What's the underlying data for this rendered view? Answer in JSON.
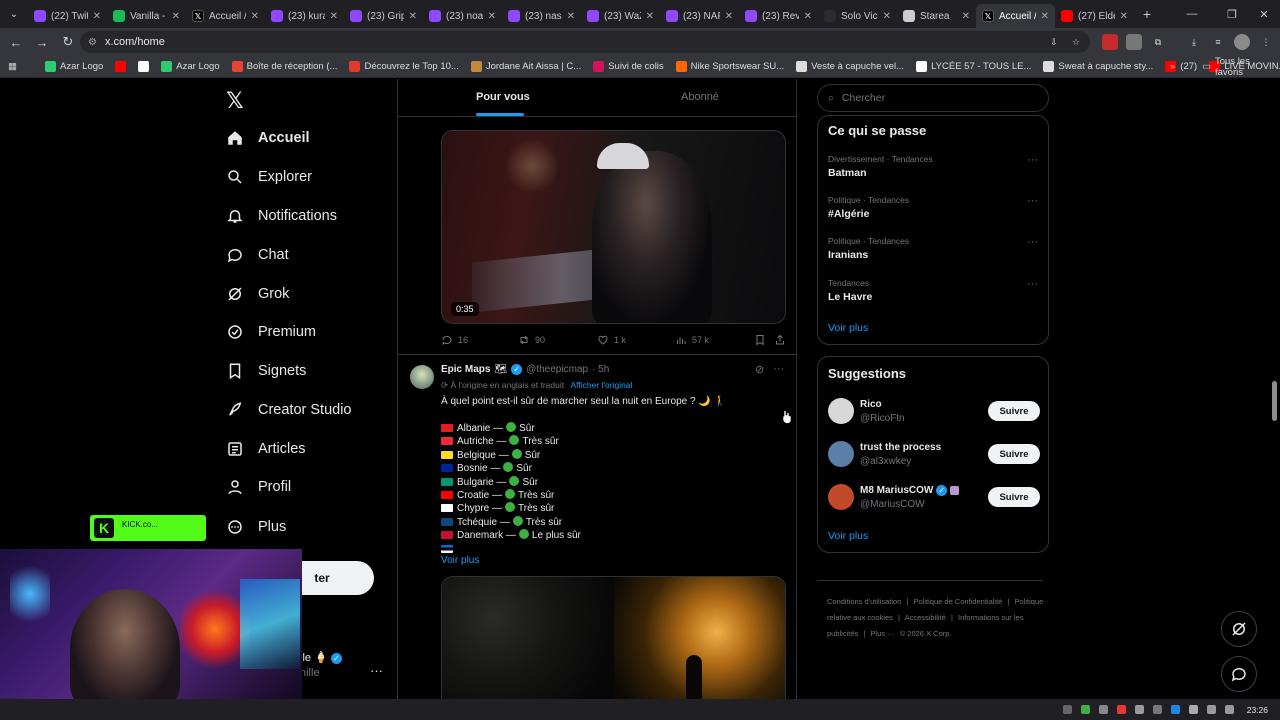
{
  "browser": {
    "tabs": [
      {
        "title": "(22) Twit",
        "color": "#9146ff",
        "icon": "twitch-icon"
      },
      {
        "title": "Vanilla -",
        "color": "#1db954",
        "icon": "spotify-icon"
      },
      {
        "title": "Accueil /",
        "color": "#000000",
        "icon": "x-icon"
      },
      {
        "title": "(23) kura",
        "color": "#9146ff",
        "icon": "twitch-icon"
      },
      {
        "title": "(23) Grip",
        "color": "#9146ff",
        "icon": "twitch-icon"
      },
      {
        "title": "(23) noal",
        "color": "#9146ff",
        "icon": "twitch-icon"
      },
      {
        "title": "(23) nas",
        "color": "#9146ff",
        "icon": "twitch-icon"
      },
      {
        "title": "(23) WaZ",
        "color": "#9146ff",
        "icon": "twitch-icon"
      },
      {
        "title": "(23) NAF",
        "color": "#9146ff",
        "icon": "twitch-icon"
      },
      {
        "title": "(23) Revi",
        "color": "#9146ff",
        "icon": "twitch-icon"
      },
      {
        "title": "Solo Vict",
        "color": "#2b2b2b",
        "icon": "globe-icon"
      },
      {
        "title": "Starea",
        "color": "#cccccc",
        "icon": "page-icon"
      },
      {
        "title": "Accueil /",
        "color": "#000000",
        "icon": "x-icon",
        "active": true
      },
      {
        "title": "(27) Elde",
        "color": "#ff0000",
        "icon": "youtube-icon"
      }
    ],
    "url": "x.com/home",
    "bookmarks": [
      {
        "label": "Azar Logo",
        "color": "#2ecc71"
      },
      {
        "label": "",
        "color": "#ff0000"
      },
      {
        "label": "",
        "color": "#ffffff"
      },
      {
        "label": "Azar Logo",
        "color": "#2ecc71"
      },
      {
        "label": "Boîte de réception (...",
        "color": "#ea4335"
      },
      {
        "label": "Découvrez le Top 10...",
        "color": "#e23a2a"
      },
      {
        "label": "Jordane Ait Aissa | C...",
        "color": "#c48a3a"
      },
      {
        "label": "Suivi de colis",
        "color": "#d4145a"
      },
      {
        "label": "Nike Sportswear SU...",
        "color": "#ff6600"
      },
      {
        "label": "Veste à capuche vel...",
        "color": "#dddddd"
      },
      {
        "label": "LYCÉE 57 - TOUS LE...",
        "color": "#ffffff"
      },
      {
        "label": "Sweat à capuche sty...",
        "color": "#dddddd"
      },
      {
        "label": "(27)",
        "color": "#ff0000"
      },
      {
        "label": "LIVE MOVIN...",
        "color": "#ff0000"
      }
    ],
    "all_bookmarks": "Tous les favoris",
    "clock": "23:26"
  },
  "sidebar": {
    "items": [
      {
        "label": "Accueil",
        "icon": "home-icon"
      },
      {
        "label": "Explorer",
        "icon": "search-icon"
      },
      {
        "label": "Notifications",
        "icon": "bell-icon"
      },
      {
        "label": "Chat",
        "icon": "chat-icon"
      },
      {
        "label": "Grok",
        "icon": "grok-icon"
      },
      {
        "label": "Premium",
        "icon": "verified-icon"
      },
      {
        "label": "Signets",
        "icon": "bookmark-icon"
      },
      {
        "label": "Creator Studio",
        "icon": "rocket-icon"
      },
      {
        "label": "Articles",
        "icon": "article-icon"
      },
      {
        "label": "Profil",
        "icon": "profile-icon"
      },
      {
        "label": "Plus",
        "icon": "more-icon"
      }
    ],
    "post_button_partial": "ter",
    "user_name_partial": "lle",
    "user_handle_partial": "nille",
    "kick_text": "KICK.co..."
  },
  "timeline": {
    "tab_for_you": "Pour vous",
    "tab_following": "Abonné",
    "post1": {
      "duration": "0:35",
      "replies": "16",
      "reposts": "90",
      "likes": "1 k",
      "views": "57 k"
    },
    "post2": {
      "name": "Epic Maps",
      "handle": "@theepicmap",
      "time": "· 5h",
      "translated_note": "À l'origine en anglais et traduit",
      "show_original": "Afficher l'original",
      "text": "À quel point est-il sûr de marcher seul la nuit en Europe ? 🌙 🚶",
      "rows": [
        {
          "country": "Albanie",
          "rating": "Sûr",
          "flag": "#e41e20"
        },
        {
          "country": "Autriche",
          "rating": "Très sûr",
          "flag": "#ed2939"
        },
        {
          "country": "Belgique",
          "rating": "Sûr",
          "flag": "#fdda24"
        },
        {
          "country": "Bosnie",
          "rating": "Sûr",
          "flag": "#002395"
        },
        {
          "country": "Bulgarie",
          "rating": "Sûr",
          "flag": "#00966e"
        },
        {
          "country": "Croatie",
          "rating": "Très sûr",
          "flag": "#ff0000"
        },
        {
          "country": "Chypre",
          "rating": "Très sûr",
          "flag": "#ffffff"
        },
        {
          "country": "Tchéquie",
          "rating": "Très sûr",
          "flag": "#11457e"
        },
        {
          "country": "Danemark",
          "rating": "Le plus sûr",
          "flag": "#c8102e"
        }
      ],
      "separator": "—",
      "see_more": "Voir plus"
    }
  },
  "right": {
    "search_placeholder": "Chercher",
    "trends_title": "Ce qui se passe",
    "trends": [
      {
        "category": "Divertissement · Tendances",
        "name": "Batman"
      },
      {
        "category": "Politique · Tendances",
        "name": "#Algérie"
      },
      {
        "category": "Politique · Tendances",
        "name": "Iranians"
      },
      {
        "category": "Tendances",
        "name": "Le Havre"
      }
    ],
    "trends_more": "Voir plus",
    "suggestions_title": "Suggestions",
    "suggestions": [
      {
        "name": "Rico",
        "handle": "@RicoFtn",
        "color": "#d8d8d8",
        "verified": false
      },
      {
        "name": "trust the process",
        "handle": "@al3xwkey",
        "color": "#5b7fa8",
        "verified": false
      },
      {
        "name": "M8 MariusCOW",
        "handle": "@MariusCOW",
        "color": "#c04a2a",
        "verified": true
      }
    ],
    "follow_label": "Suivre",
    "suggestions_more": "Voir plus",
    "footer": [
      "Conditions d'utilisation",
      "|",
      "Politique de Confidentialité",
      "|",
      "Politique relative aux cookies",
      "|",
      "Accessibilité",
      "|",
      "Informations sur les publicités",
      "|",
      "Plus ···",
      "© 2026 X Corp."
    ]
  },
  "colors": {
    "accent": "#1d9bf0",
    "safe_dot": "#3cb043",
    "kick_green": "#53fc18"
  }
}
